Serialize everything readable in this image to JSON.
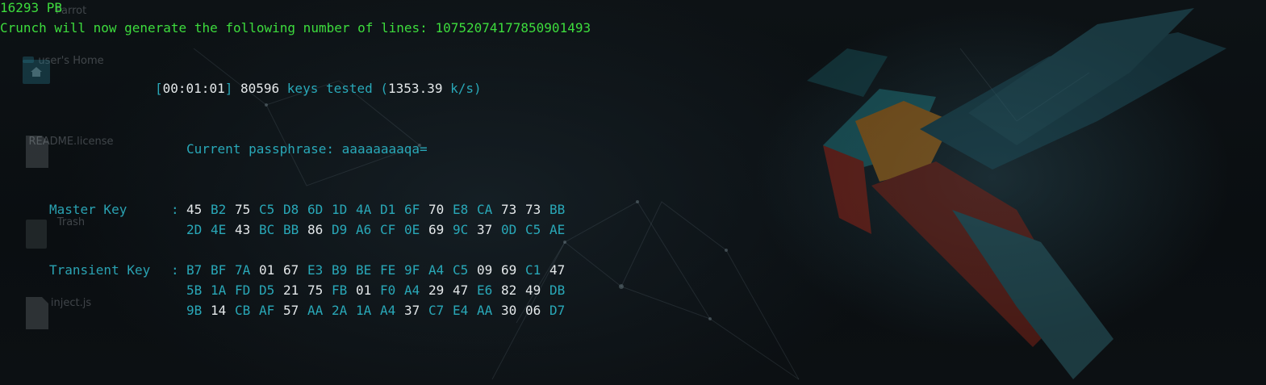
{
  "desktop": {
    "icons": [
      {
        "label": "Parrot",
        "icon": "folder-icon"
      },
      {
        "label": "user's Home",
        "icon": "home-folder-icon"
      },
      {
        "label": "README.license",
        "icon": "file-icon"
      },
      {
        "label": "Trash",
        "icon": "trash-icon"
      },
      {
        "label": "inject.js",
        "icon": "file-icon"
      }
    ]
  },
  "terminal": {
    "size_line": "16293 PB",
    "crunch_line": "Crunch will now generate the following number of lines: 10752074177850901493",
    "status": {
      "time_open": "[",
      "elapsed": "00:01:01",
      "time_close": "]",
      "keys": "80596",
      "keys_text": "keys tested (",
      "rate": "1353.39",
      "rate_unit": "k/s)"
    },
    "passphrase_label": "Current passphrase:",
    "passphrase": "aaaaaaaaqa=",
    "master_key": {
      "label": "Master Key",
      "separator": ":",
      "rows": [
        [
          "45",
          "B2",
          "75",
          "C5",
          "D8",
          "6D",
          "1D",
          "4A",
          "D1",
          "6F",
          "70",
          "E8",
          "CA",
          "73",
          "73",
          "BB"
        ],
        [
          "2D",
          "4E",
          "43",
          "BC",
          "BB",
          "86",
          "D9",
          "A6",
          "CF",
          "0E",
          "69",
          "9C",
          "37",
          "0D",
          "C5",
          "AE"
        ]
      ]
    },
    "transient_key": {
      "label": "Transient Key",
      "separator": ":",
      "rows": [
        [
          "B7",
          "BF",
          "7A",
          "01",
          "67",
          "E3",
          "B9",
          "BE",
          "FE",
          "9F",
          "A4",
          "C5",
          "09",
          "69",
          "C1",
          "47"
        ],
        [
          "5B",
          "1A",
          "FD",
          "D5",
          "21",
          "75",
          "FB",
          "01",
          "F0",
          "A4",
          "29",
          "47",
          "E6",
          "82",
          "49",
          "DB"
        ],
        [
          "9B",
          "14",
          "CB",
          "AF",
          "57",
          "AA",
          "2A",
          "1A",
          "A4",
          "37",
          "C7",
          "E4",
          "AA",
          "30",
          "06",
          "D7"
        ]
      ]
    },
    "colors": {
      "green": "#3ddc3d",
      "cyan": "#29a8b8",
      "white": "#e4e8ea"
    }
  }
}
